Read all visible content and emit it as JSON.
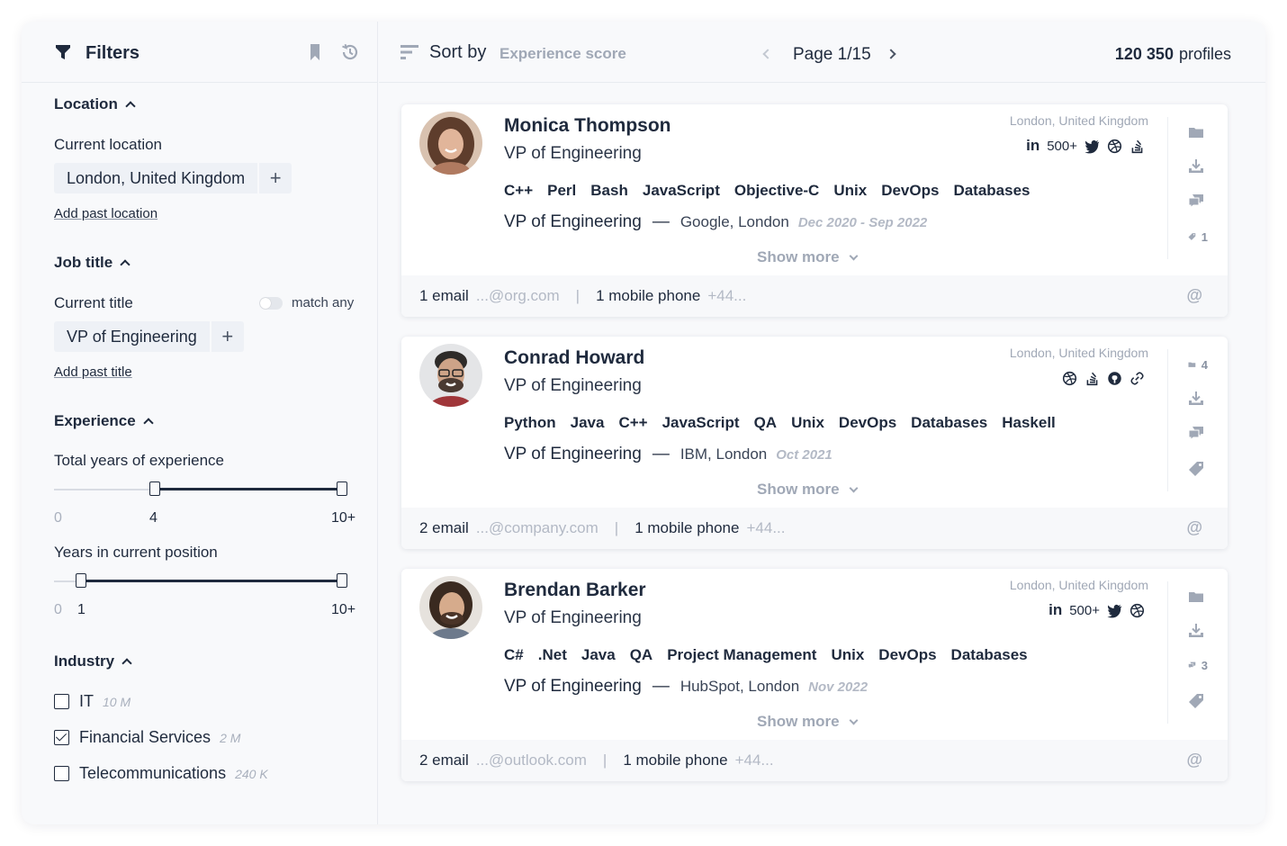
{
  "sidebar": {
    "title": "Filters",
    "location": {
      "title": "Location",
      "current_label": "Current location",
      "current_value": "London, United Kingdom",
      "add_past": "Add past location"
    },
    "job_title": {
      "title": "Job title",
      "current_label": "Current title",
      "match_any": "match any",
      "current_value": "VP of Engineering",
      "add_past": "Add past title"
    },
    "experience": {
      "title": "Experience",
      "total_label": "Total years of experience",
      "total_min": "0",
      "total_low": "4",
      "total_max": "10+",
      "total_range": [
        4,
        10
      ],
      "position_label": "Years in current position",
      "position_min": "0",
      "position_low": "1",
      "position_max": "10+",
      "position_range": [
        1,
        10
      ]
    },
    "industry": {
      "title": "Industry",
      "items": [
        {
          "label": "IT",
          "count": "10 M",
          "checked": false
        },
        {
          "label": "Financial Services",
          "count": "2 M",
          "checked": true
        },
        {
          "label": "Telecommunications",
          "count": "240 K",
          "checked": false
        }
      ]
    }
  },
  "topbar": {
    "sort_label": "Sort by",
    "sort_value": "Experience score",
    "page_text": "Page 1/15",
    "profiles_count": "120 350",
    "profiles_label": "profiles"
  },
  "cards": [
    {
      "name": "Monica Thompson",
      "title": "VP of Engineering",
      "location": "London, United Kingdom",
      "linkedin": "500+",
      "skills": [
        "C++",
        "Perl",
        "Bash",
        "JavaScript",
        "Objective-C",
        "Unix",
        "DevOps",
        "Databases"
      ],
      "position": "VP of Engineering",
      "company": "Google, London",
      "dates": "Dec 2020 - Sep 2022",
      "show_more": "Show more",
      "emails": "1 email",
      "email_domain": "...@org.com",
      "phones": "1 mobile phone",
      "phone_prefix": "+44...",
      "tag_count": "1",
      "avatar_colors": [
        "#6b4a3a",
        "#c99680"
      ]
    },
    {
      "name": "Conrad Howard",
      "title": "VP of Engineering",
      "location": "London, United Kingdom",
      "skills": [
        "Python",
        "Java",
        "C++",
        "JavaScript",
        "QA",
        "Unix",
        "DevOps",
        "Databases",
        "Haskell"
      ],
      "position": "VP of Engineering",
      "company": "IBM, London",
      "dates": "Oct 2021",
      "show_more": "Show more",
      "emails": "2 email",
      "email_domain": "...@company.com",
      "phones": "1 mobile phone",
      "phone_prefix": "+44...",
      "folder_count": "4",
      "avatar_colors": [
        "#3b3a38",
        "#c9a184"
      ]
    },
    {
      "name": "Brendan Barker",
      "title": "VP of Engineering",
      "location": "London, United Kingdom",
      "linkedin": "500+",
      "skills": [
        "C#",
        ".Net",
        "Java",
        "QA",
        "Project Management",
        "Unix",
        "DevOps",
        "Databases"
      ],
      "position": "VP of Engineering",
      "company": "HubSpot, London",
      "dates": "Nov 2022",
      "show_more": "Show more",
      "emails": "2 email",
      "email_domain": "...@outlook.com",
      "phones": "1 mobile phone",
      "phone_prefix": "+44...",
      "comment_count": "3",
      "avatar_colors": [
        "#4a3428",
        "#d0a687"
      ]
    }
  ],
  "colors": {
    "text": "#1f2a3d",
    "muted": "#a0a8b6",
    "chip": "#eef1f6",
    "panel": "#f8f9fb"
  }
}
